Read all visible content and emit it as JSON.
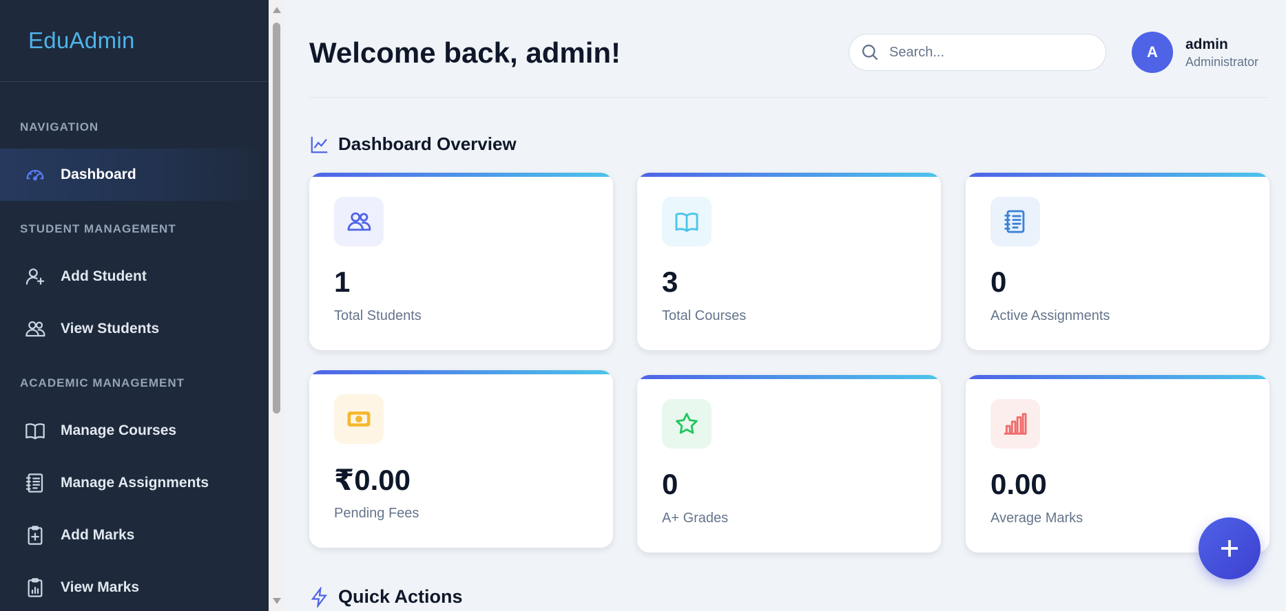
{
  "sidebar": {
    "brand": "EduAdmin",
    "sections": {
      "navigation": "NAVIGATION",
      "student_management": "STUDENT MANAGEMENT",
      "academic_management": "ACADEMIC MANAGEMENT"
    },
    "items": {
      "dashboard": {
        "label": "Dashboard",
        "icon": "speedometer-icon"
      },
      "add_student": {
        "label": "Add Student",
        "icon": "user-plus-icon"
      },
      "view_students": {
        "label": "View Students",
        "icon": "users-icon"
      },
      "manage_courses": {
        "label": "Manage Courses",
        "icon": "book-icon"
      },
      "manage_assignments": {
        "label": "Manage Assignments",
        "icon": "notebook-icon"
      },
      "add_marks": {
        "label": "Add Marks",
        "icon": "clipboard-plus-icon"
      },
      "view_marks": {
        "label": "View Marks",
        "icon": "clipboard-chart-icon"
      }
    }
  },
  "header": {
    "welcome": "Welcome back, admin!",
    "search_placeholder": "Search...",
    "avatar_initial": "A",
    "user_name": "admin",
    "user_role": "Administrator"
  },
  "overview": {
    "title": "Dashboard Overview",
    "cards": [
      {
        "value": "1",
        "label": "Total Students",
        "icon": "users-icon",
        "icon_color": "#4f63e7",
        "icon_bg": "#eef0fd"
      },
      {
        "value": "3",
        "label": "Total Courses",
        "icon": "book-icon",
        "icon_color": "#4cc4ea",
        "icon_bg": "#eaf7fd"
      },
      {
        "value": "0",
        "label": "Active Assignments",
        "icon": "notebook-icon",
        "icon_color": "#3b82d6",
        "icon_bg": "#eaf2fc"
      },
      {
        "value": "₹0.00",
        "label": "Pending Fees",
        "icon": "cash-icon",
        "icon_color": "#f5b82e",
        "icon_bg": "#fef5e4"
      },
      {
        "value": "0",
        "label": "A+ Grades",
        "icon": "star-icon",
        "icon_color": "#22c55e",
        "icon_bg": "#e8f8ee"
      },
      {
        "value": "0.00",
        "label": "Average Marks",
        "icon": "bar-chart-icon",
        "icon_color": "#ef6b6b",
        "icon_bg": "#fdeeee"
      }
    ]
  },
  "quick_actions": {
    "title": "Quick Actions"
  },
  "fab": {
    "icon": "plus-icon"
  }
}
